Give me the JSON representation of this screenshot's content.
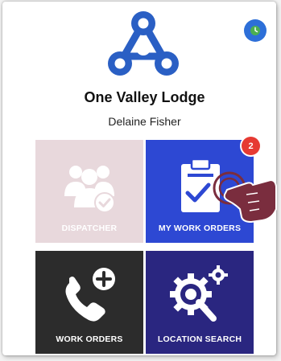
{
  "organization": {
    "name": "One Valley Lodge"
  },
  "user": {
    "name": "Delaine Fisher"
  },
  "tiles": {
    "dispatcher": {
      "label": "DISPATCHER"
    },
    "my_work_orders": {
      "label": "MY WORK ORDERS",
      "badge_count": "2"
    },
    "work_orders": {
      "label": "WORK ORDERS"
    },
    "location_search": {
      "label": "LOCATION SEARCH"
    }
  },
  "icons": {
    "logo": "triangle-rings-logo",
    "status": "clock-icon",
    "dispatcher": "people-check-icon",
    "my_work_orders": "clipboard-check-icon",
    "work_orders": "phone-plus-icon",
    "location_search": "gear-magnifier-icon",
    "pointer": "pointing-hand-icon"
  },
  "colors": {
    "accent_blue": "#2d6fd8",
    "logo_blue": "#2a5fc4",
    "dispatcher_tile": "#e8d8dc",
    "my_work_orders_tile": "#2d48d3",
    "work_orders_tile": "#2c2c2c",
    "location_search_tile": "#2a2680",
    "badge_red": "#e63a33",
    "hand": "#7a2d3e"
  }
}
